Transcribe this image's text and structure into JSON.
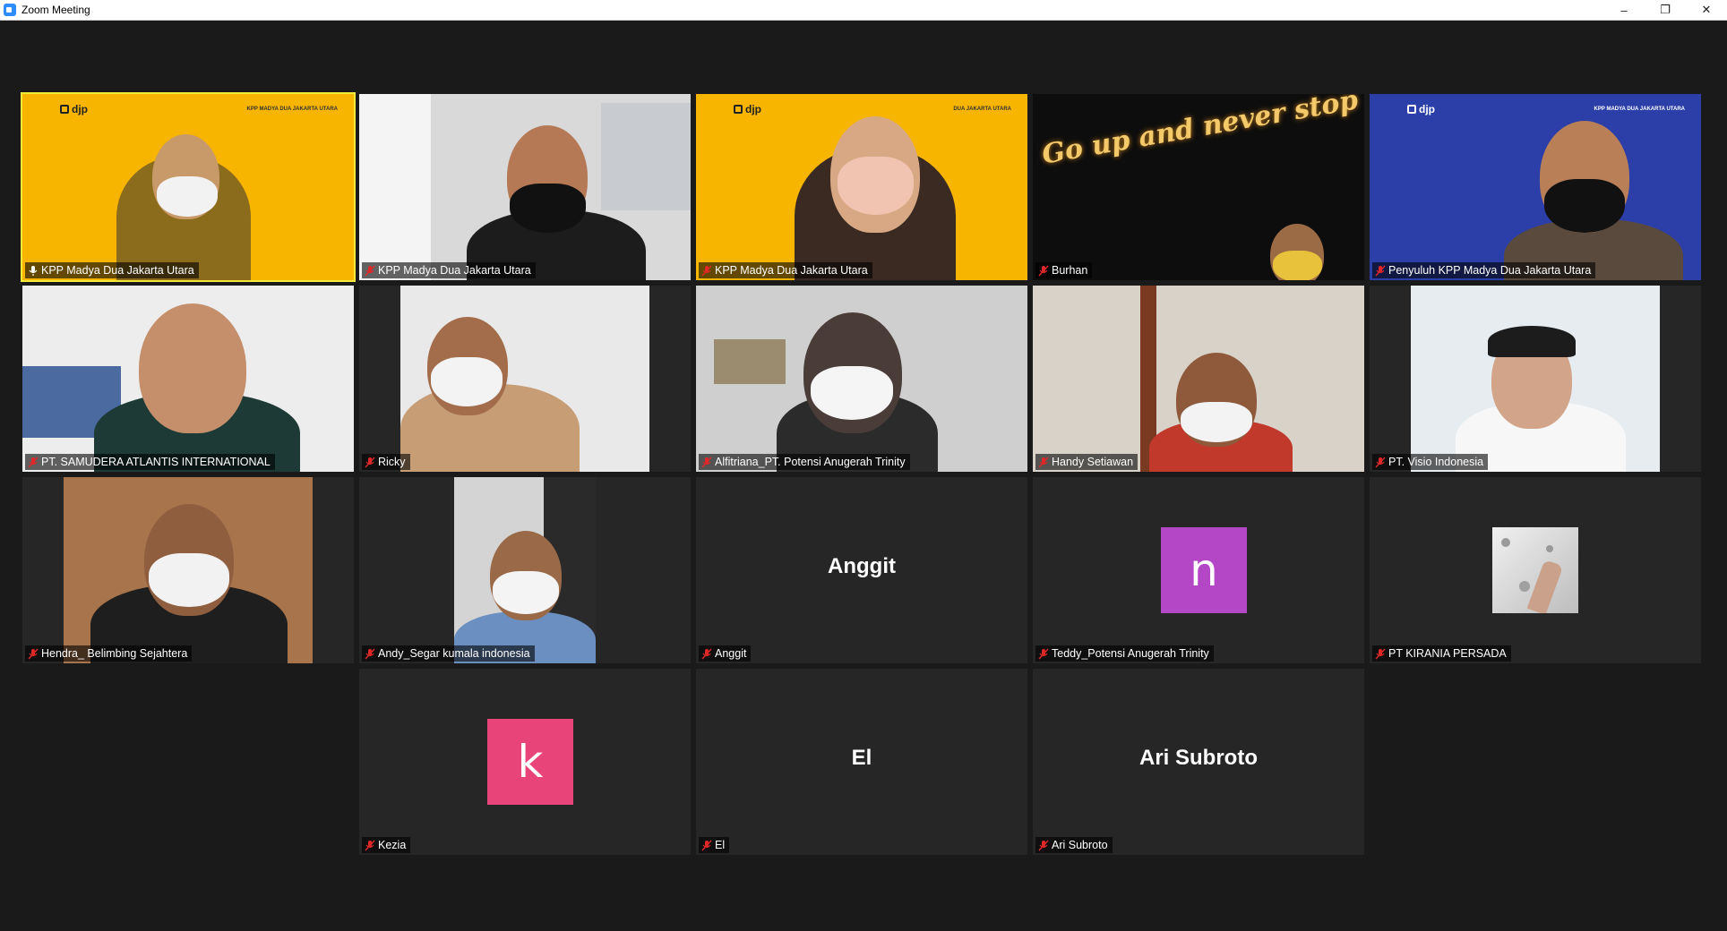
{
  "window": {
    "title": "Zoom Meeting",
    "minimize": "–",
    "restore": "❐",
    "close": "✕"
  },
  "tiles": [
    {
      "name": "KPP Madya Dua Jakarta Utara",
      "mic": "unmuted",
      "active": true
    },
    {
      "name": "KPP Madya Dua Jakarta Utara",
      "mic": "muted"
    },
    {
      "name": "KPP Madya Dua Jakarta Utara",
      "mic": "muted"
    },
    {
      "name": "Burhan",
      "mic": "muted",
      "overlay": "Go up and never stop"
    },
    {
      "name": "Penyuluh KPP Madya Dua Jakarta Utara",
      "mic": "muted"
    },
    {
      "name": "PT. SAMUDERA ATLANTIS INTERNATIONAL",
      "mic": "muted"
    },
    {
      "name": "Ricky",
      "mic": "muted"
    },
    {
      "name": "Alfitriana_PT. Potensi Anugerah Trinity",
      "mic": "muted"
    },
    {
      "name": "Handy Setiawan",
      "mic": "muted"
    },
    {
      "name": "PT. Visio Indonesia",
      "mic": "muted"
    },
    {
      "name": "Hendra_ Belimbing Sejahtera",
      "mic": "muted"
    },
    {
      "name": "Andy_Segar kumala indonesia",
      "mic": "muted"
    },
    {
      "name": "Anggit",
      "mic": "muted",
      "display": "Anggit"
    },
    {
      "name": "Teddy_Potensi Anugerah Trinity",
      "mic": "muted",
      "avatar": "n"
    },
    {
      "name": "PT KIRANIA PERSADA",
      "mic": "muted"
    },
    {
      "name": "Kezia",
      "mic": "muted",
      "avatar": "k"
    },
    {
      "name": "El",
      "mic": "muted",
      "display": "El"
    },
    {
      "name": "Ari Subroto",
      "mic": "muted",
      "display": "Ari Subroto"
    }
  ],
  "branding": {
    "djp": "djp",
    "kpp_tag": "KPP MADYA DUA JAKARTA UTARA",
    "kpp_tag_short": "DUA JAKARTA UTARA"
  },
  "colors": {
    "background": "#1a1a1a",
    "tile": "#262626",
    "speaking_outline": "#f2e83a",
    "muted_icon": "#e02828",
    "avatar_n": "#b447c6",
    "avatar_k": "#e8447a",
    "djp_yellow": "#f7b500",
    "djp_blue": "#2c3fa8"
  }
}
